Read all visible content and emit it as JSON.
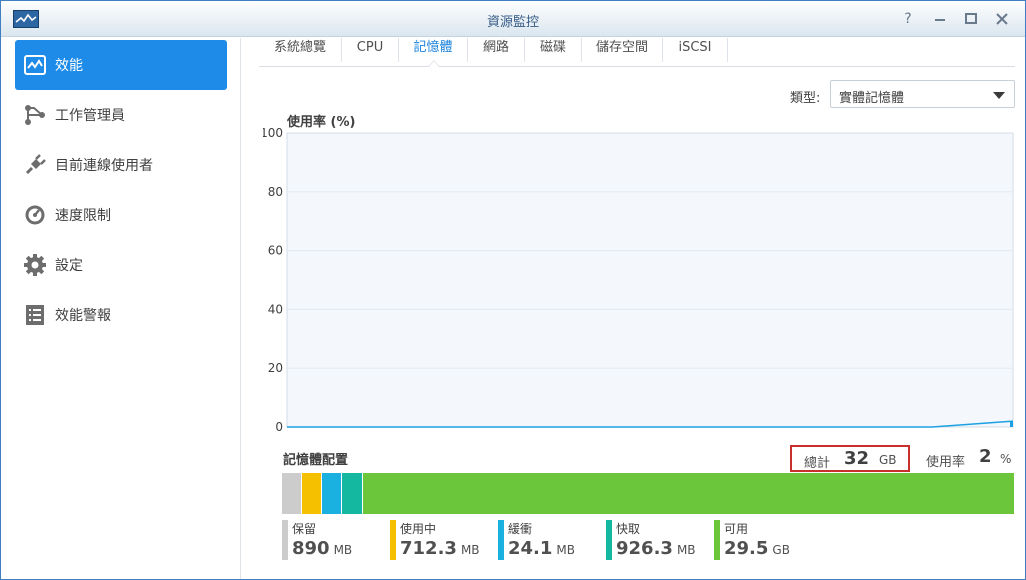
{
  "window": {
    "title": "資源監控"
  },
  "sidebar": {
    "items": [
      {
        "label": "效能",
        "icon": "performance-chart-icon",
        "active": true
      },
      {
        "label": "工作管理員",
        "icon": "task-manager-icon",
        "active": false
      },
      {
        "label": "目前連線使用者",
        "icon": "plug-icon",
        "active": false
      },
      {
        "label": "速度限制",
        "icon": "speedometer-icon",
        "active": false
      },
      {
        "label": "設定",
        "icon": "gear-icon",
        "active": false
      },
      {
        "label": "效能警報",
        "icon": "alert-list-icon",
        "active": false
      }
    ]
  },
  "tabs": [
    {
      "label": "系統總覽",
      "active": false
    },
    {
      "label": "CPU",
      "active": false
    },
    {
      "label": "記憶體",
      "active": true
    },
    {
      "label": "網路",
      "active": false
    },
    {
      "label": "磁碟",
      "active": false
    },
    {
      "label": "儲存空間",
      "active": false
    },
    {
      "label": "iSCSI",
      "active": false
    }
  ],
  "type_selector": {
    "label": "類型:",
    "value": "實體記憶體"
  },
  "chart_data": {
    "type": "area",
    "title": "使用率 (%)",
    "ylabel": "使用率 (%)",
    "xlabel": "",
    "ylim": [
      0,
      100
    ],
    "yticks": [
      "0",
      "20",
      "40",
      "60",
      "80",
      "100"
    ],
    "grid": true,
    "series": [
      {
        "values": [
          0,
          0,
          0,
          0,
          0,
          0,
          0,
          0,
          0,
          2
        ]
      }
    ],
    "colors": {
      "line": "#1ba1e2",
      "plot_bg": "#f4f8fc",
      "grid": "#e1e9f0"
    }
  },
  "memory": {
    "title": "記憶體配置",
    "total_label": "總計",
    "total_value": "32",
    "total_unit": "GB",
    "usage_label": "使用率",
    "usage_value": "2",
    "usage_unit": "%",
    "segments": [
      {
        "name": "保留",
        "value": "890",
        "unit": "MB",
        "mb": 890,
        "color": "#cccccc"
      },
      {
        "name": "使用中",
        "value": "712.3",
        "unit": "MB",
        "mb": 712.3,
        "color": "#f5c000"
      },
      {
        "name": "緩衝",
        "value": "24.1",
        "unit": "MB",
        "mb": 24.1,
        "color": "#1ab1e0"
      },
      {
        "name": "快取",
        "value": "926.3",
        "unit": "MB",
        "mb": 926.3,
        "color": "#14b8a0"
      },
      {
        "name": "可用",
        "value": "29.5",
        "unit": "GB",
        "mb": 30208,
        "color": "#6cc63c"
      }
    ]
  }
}
